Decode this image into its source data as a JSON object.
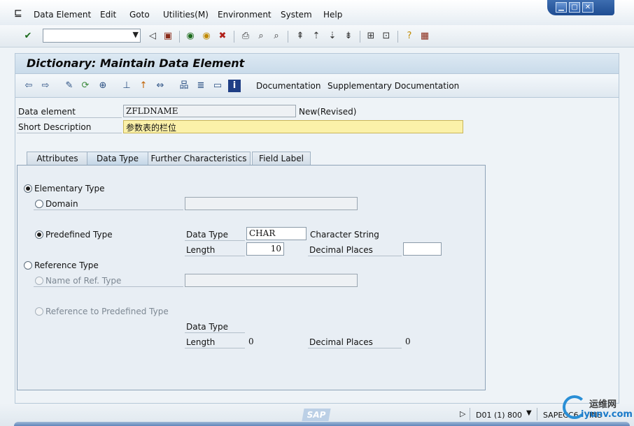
{
  "menu": {
    "items": [
      "Data Element",
      "Edit",
      "Goto",
      "Utilities(M)",
      "Environment",
      "System",
      "Help"
    ]
  },
  "window_controls": {
    "minimize": "▁",
    "maximize": "▢",
    "close": "✕"
  },
  "title": "Dictionary: Maintain Data Element",
  "app_toolbar": {
    "documentation": "Documentation",
    "supplementary_documentation": "Supplementary Documentation"
  },
  "header_fields": {
    "data_element_label": "Data element",
    "data_element_value": "ZFLDNAME",
    "status": "New(Revised)",
    "short_description_label": "Short Description",
    "short_description_value": "参数表的栏位"
  },
  "tabs": [
    {
      "label": "Attributes",
      "active": false
    },
    {
      "label": "Data Type",
      "active": true
    },
    {
      "label": "Further Characteristics",
      "active": false
    },
    {
      "label": "Field Label",
      "active": false
    }
  ],
  "panel": {
    "elementary_type": "Elementary Type",
    "domain": "Domain",
    "domain_value": "",
    "predefined_type": "Predefined Type",
    "data_type_label": "Data Type",
    "data_type_value": "CHAR",
    "data_type_desc": "Character String",
    "length_label": "Length",
    "length_value": "10",
    "decimal_places_label": "Decimal Places",
    "decimal_places_value": "",
    "reference_type": "Reference Type",
    "name_of_ref_type": "Name of Ref. Type",
    "name_of_ref_type_value": "",
    "reference_to_predefined": "Reference to Predefined Type",
    "ref_data_type_label": "Data Type",
    "ref_length_label": "Length",
    "ref_length_value": "0",
    "ref_decimal_places_label": "Decimal Places",
    "ref_decimal_places_value": "0"
  },
  "status_bar": {
    "sap_logo": "SAP",
    "system": "D01 (1) 800",
    "server": "SAPECC6",
    "mode": "INS"
  },
  "watermark": {
    "text_cn": "运维网",
    "url": "iyunv.com"
  },
  "colors": {
    "menubar": "#f0f4f8",
    "title_bg": "#d3e2ef",
    "yellow_field": "#fbf1a9",
    "tab_panel": "#e8eef4"
  }
}
